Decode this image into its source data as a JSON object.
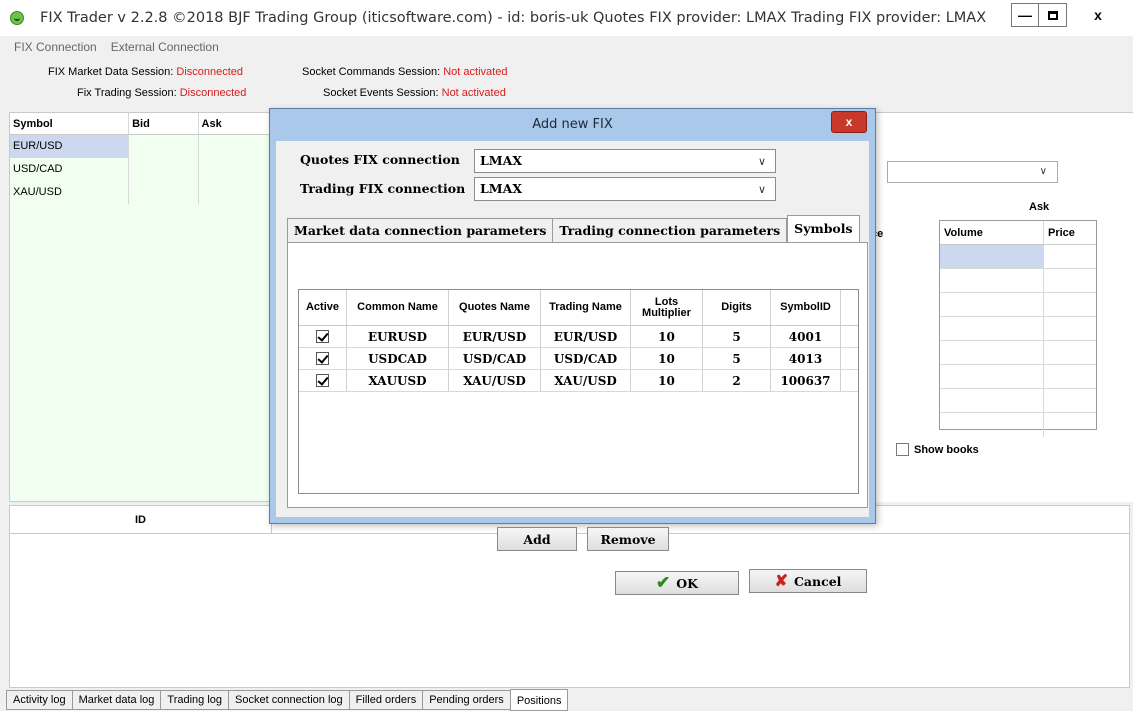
{
  "window": {
    "title": "FIX Trader v 2.2.8 ©2018 BJF Trading Group (iticsoftware.com) - id: boris-uk Quotes FIX provider: LMAX Trading FIX provider: LMAX",
    "close_label": "x"
  },
  "menu": {
    "items": [
      "FIX Connection",
      "External Connection"
    ]
  },
  "status": {
    "market_data_label": "FIX Market Data Session:",
    "market_data_value": "Disconnected",
    "trading_label": "Fix Trading Session:",
    "trading_value": "Disconnected",
    "socket_commands_label": "Socket Commands Session:",
    "socket_commands_value": "Not activated",
    "socket_events_label": "Socket Events Session:",
    "socket_events_value": "Not activated"
  },
  "quotes_table": {
    "headers": [
      "Symbol",
      "Bid",
      "Ask"
    ],
    "rows": [
      {
        "symbol": "EUR/USD",
        "bid": "",
        "ask": ""
      },
      {
        "symbol": "USD/CAD",
        "bid": "",
        "ask": ""
      },
      {
        "symbol": "XAU/USD",
        "bid": "",
        "ask": ""
      }
    ]
  },
  "order_book": {
    "partial_label": "ce",
    "ask_label": "Ask",
    "headers": [
      "Volume",
      "Price"
    ],
    "show_books_label": "Show books"
  },
  "bottom": {
    "id_header": "ID"
  },
  "bottom_tabs": [
    "Activity log",
    "Market data log",
    "Trading log",
    "Socket connection log",
    "Filled orders",
    "Pending orders",
    "Positions"
  ],
  "dialog": {
    "title": "Add new FIX",
    "close_label": "x",
    "quotes_label": "Quotes FIX connection",
    "quotes_value": "LMAX",
    "trading_label": "Trading FIX connection",
    "trading_value": "LMAX",
    "tabs": [
      "Market data connection parameters",
      "Trading connection parameters",
      "Symbols"
    ],
    "symbols_headers": [
      "Active",
      "Common Name",
      "Quotes Name",
      "Trading Name",
      "Lots Multiplier",
      "Digits",
      "SymbolID"
    ],
    "symbols": [
      {
        "common": "EURUSD",
        "quotes": "EUR/USD",
        "trading": "EUR/USD",
        "lots": "10",
        "digits": "5",
        "id": "4001"
      },
      {
        "common": "USDCAD",
        "quotes": "USD/CAD",
        "trading": "USD/CAD",
        "lots": "10",
        "digits": "5",
        "id": "4013"
      },
      {
        "common": "XAUUSD",
        "quotes": "XAU/USD",
        "trading": "XAU/USD",
        "lots": "10",
        "digits": "2",
        "id": "100637"
      }
    ],
    "add_label": "Add",
    "remove_label": "Remove",
    "ok_label": "OK",
    "cancel_label": "Cancel"
  }
}
